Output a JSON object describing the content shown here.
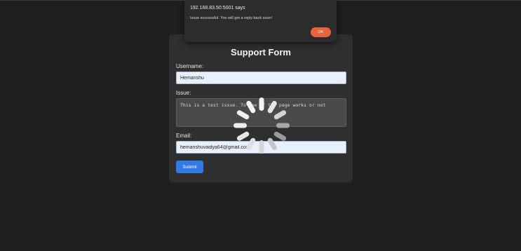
{
  "alert": {
    "origin": "192.168.83.50:5001 says",
    "message": "Issue successful. You will get a reply back soon!",
    "ok_label": "OK"
  },
  "form": {
    "title": "Support Form",
    "username_label": "Username:",
    "username_value": "Hemanshu",
    "issue_label": "Issue:",
    "issue_value": "This is a test issue. To see if the page works or not",
    "email_label": "Email:",
    "email_value": "hemanshuvaidya64@gmail.com",
    "submit_label": "Submit"
  },
  "colors": {
    "background": "#1e1e1e",
    "card": "#2f2f2f",
    "submit": "#2f7ae5",
    "ok": "#e8643c"
  },
  "icons": {
    "spinner": "loading-spinner-icon"
  }
}
